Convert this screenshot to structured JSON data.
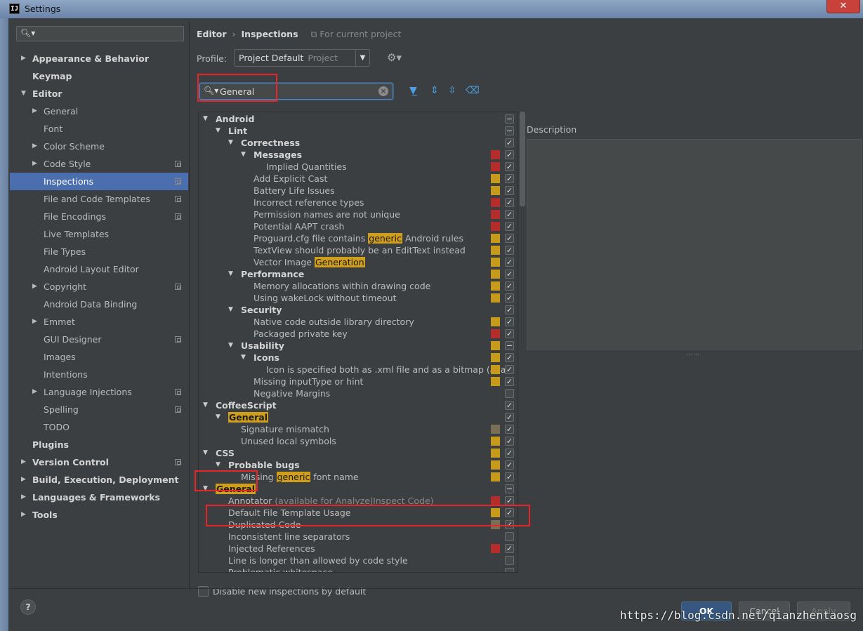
{
  "window": {
    "title": "Settings",
    "app_icon": "IJ",
    "close": "✕"
  },
  "sidebar": {
    "search_placeholder": "",
    "items": [
      {
        "label": "Appearance & Behavior",
        "bold": true,
        "arrow": "▶",
        "level": 0,
        "proj": false
      },
      {
        "label": "Keymap",
        "bold": true,
        "arrow": "",
        "level": 0,
        "proj": false
      },
      {
        "label": "Editor",
        "bold": true,
        "arrow": "▼",
        "level": 0,
        "proj": false
      },
      {
        "label": "General",
        "bold": false,
        "arrow": "▶",
        "level": 1,
        "proj": false
      },
      {
        "label": "Font",
        "bold": false,
        "arrow": "",
        "level": 1,
        "proj": false
      },
      {
        "label": "Color Scheme",
        "bold": false,
        "arrow": "▶",
        "level": 1,
        "proj": false
      },
      {
        "label": "Code Style",
        "bold": false,
        "arrow": "▶",
        "level": 1,
        "proj": true
      },
      {
        "label": "Inspections",
        "bold": false,
        "arrow": "",
        "level": 1,
        "proj": true,
        "selected": true
      },
      {
        "label": "File and Code Templates",
        "bold": false,
        "arrow": "",
        "level": 1,
        "proj": true
      },
      {
        "label": "File Encodings",
        "bold": false,
        "arrow": "",
        "level": 1,
        "proj": true
      },
      {
        "label": "Live Templates",
        "bold": false,
        "arrow": "",
        "level": 1,
        "proj": false
      },
      {
        "label": "File Types",
        "bold": false,
        "arrow": "",
        "level": 1,
        "proj": false
      },
      {
        "label": "Android Layout Editor",
        "bold": false,
        "arrow": "",
        "level": 1,
        "proj": false
      },
      {
        "label": "Copyright",
        "bold": false,
        "arrow": "▶",
        "level": 1,
        "proj": true
      },
      {
        "label": "Android Data Binding",
        "bold": false,
        "arrow": "",
        "level": 1,
        "proj": false
      },
      {
        "label": "Emmet",
        "bold": false,
        "arrow": "▶",
        "level": 1,
        "proj": false
      },
      {
        "label": "GUI Designer",
        "bold": false,
        "arrow": "",
        "level": 1,
        "proj": true
      },
      {
        "label": "Images",
        "bold": false,
        "arrow": "",
        "level": 1,
        "proj": false
      },
      {
        "label": "Intentions",
        "bold": false,
        "arrow": "",
        "level": 1,
        "proj": false
      },
      {
        "label": "Language Injections",
        "bold": false,
        "arrow": "▶",
        "level": 1,
        "proj": true
      },
      {
        "label": "Spelling",
        "bold": false,
        "arrow": "",
        "level": 1,
        "proj": true
      },
      {
        "label": "TODO",
        "bold": false,
        "arrow": "",
        "level": 1,
        "proj": false
      },
      {
        "label": "Plugins",
        "bold": true,
        "arrow": "",
        "level": 0,
        "proj": false
      },
      {
        "label": "Version Control",
        "bold": true,
        "arrow": "▶",
        "level": 0,
        "proj": true
      },
      {
        "label": "Build, Execution, Deployment",
        "bold": true,
        "arrow": "▶",
        "level": 0,
        "proj": false
      },
      {
        "label": "Languages & Frameworks",
        "bold": true,
        "arrow": "▶",
        "level": 0,
        "proj": false
      },
      {
        "label": "Tools",
        "bold": true,
        "arrow": "▶",
        "level": 0,
        "proj": false
      }
    ]
  },
  "breadcrumb": {
    "part1": "Editor",
    "sep": "›",
    "part2": "Inspections",
    "scope": "For current project"
  },
  "profile": {
    "label": "Profile:",
    "value": "Project Default",
    "sub": "Project"
  },
  "filter": {
    "value": "General"
  },
  "colors": {
    "error": "#b52c2a",
    "warning": "#c89a1a",
    "weak": "#7a6e55",
    "highlight": "#cf9e1c",
    "selection": "#4b6eaf"
  },
  "inspections": [
    {
      "label": "Android",
      "level": 0,
      "arrow": "▼",
      "bold": true,
      "sev": "",
      "check": "minus"
    },
    {
      "label": "Lint",
      "level": 1,
      "arrow": "▼",
      "bold": true,
      "sev": "",
      "check": "minus"
    },
    {
      "label": "Correctness",
      "level": 2,
      "arrow": "▼",
      "bold": true,
      "sev": "",
      "check": "on"
    },
    {
      "label": "Messages",
      "level": 3,
      "arrow": "▼",
      "bold": true,
      "sev": "error",
      "check": "on"
    },
    {
      "label": "Implied Quantities",
      "level": 4,
      "arrow": "",
      "bold": false,
      "sev": "error",
      "check": "on"
    },
    {
      "label": "Add Explicit Cast",
      "level": 3,
      "arrow": "",
      "bold": false,
      "sev": "warning",
      "check": "on"
    },
    {
      "label": "Battery Life Issues",
      "level": 3,
      "arrow": "",
      "bold": false,
      "sev": "warning",
      "check": "on"
    },
    {
      "label": "Incorrect reference types",
      "level": 3,
      "arrow": "",
      "bold": false,
      "sev": "error",
      "check": "on"
    },
    {
      "label": "Permission names are not unique",
      "level": 3,
      "arrow": "",
      "bold": false,
      "sev": "error",
      "check": "on"
    },
    {
      "label": "Potential AAPT crash",
      "level": 3,
      "arrow": "",
      "bold": false,
      "sev": "error",
      "check": "on"
    },
    {
      "label": "Proguard.cfg file contains ",
      "hl": "generic",
      "after": " Android rules",
      "level": 3,
      "arrow": "",
      "bold": false,
      "sev": "warning",
      "check": "on"
    },
    {
      "label": "TextView should probably be an EditText instead",
      "level": 3,
      "arrow": "",
      "bold": false,
      "sev": "warning",
      "check": "on"
    },
    {
      "label": "Vector Image ",
      "hl": "Generation",
      "after": "",
      "level": 3,
      "arrow": "",
      "bold": false,
      "sev": "warning",
      "check": "on"
    },
    {
      "label": "Performance",
      "level": 2,
      "arrow": "▼",
      "bold": true,
      "sev": "warning",
      "check": "on"
    },
    {
      "label": "Memory allocations within drawing code",
      "level": 3,
      "arrow": "",
      "bold": false,
      "sev": "warning",
      "check": "on"
    },
    {
      "label": "Using wakeLock without timeout",
      "level": 3,
      "arrow": "",
      "bold": false,
      "sev": "warning",
      "check": "on"
    },
    {
      "label": "Security",
      "level": 2,
      "arrow": "▼",
      "bold": true,
      "sev": "",
      "check": "on"
    },
    {
      "label": "Native code outside library directory",
      "level": 3,
      "arrow": "",
      "bold": false,
      "sev": "warning",
      "check": "on"
    },
    {
      "label": "Packaged private key",
      "level": 3,
      "arrow": "",
      "bold": false,
      "sev": "error",
      "check": "on"
    },
    {
      "label": "Usability",
      "level": 2,
      "arrow": "▼",
      "bold": true,
      "sev": "warning",
      "check": "minus"
    },
    {
      "label": "Icons",
      "level": 3,
      "arrow": "▼",
      "bold": true,
      "sev": "warning",
      "check": "on"
    },
    {
      "label": "Icon is specified both as .xml file and as a bitmap (avai",
      "level": 4,
      "arrow": "",
      "bold": false,
      "sev": "warning",
      "check": "on"
    },
    {
      "label": "Missing inputType or hint",
      "level": 3,
      "arrow": "",
      "bold": false,
      "sev": "warning",
      "check": "on"
    },
    {
      "label": "Negative Margins",
      "level": 3,
      "arrow": "",
      "bold": false,
      "sev": "",
      "check": "off"
    },
    {
      "label": "CoffeeScript",
      "level": 0,
      "arrow": "▼",
      "bold": true,
      "sev": "",
      "check": "on"
    },
    {
      "label": "",
      "hl": "General",
      "after": "",
      "level": 1,
      "arrow": "▼",
      "bold": true,
      "sev": "",
      "check": "on"
    },
    {
      "label": "Signature mismatch",
      "level": 2,
      "arrow": "",
      "bold": false,
      "sev": "weak",
      "check": "on"
    },
    {
      "label": "Unused local symbols",
      "level": 2,
      "arrow": "",
      "bold": false,
      "sev": "warning",
      "check": "on"
    },
    {
      "label": "CSS",
      "level": 0,
      "arrow": "▼",
      "bold": true,
      "sev": "warning",
      "check": "on"
    },
    {
      "label": "Probable bugs",
      "level": 1,
      "arrow": "▼",
      "bold": true,
      "sev": "warning",
      "check": "on"
    },
    {
      "label": "Missing ",
      "hl": "generic",
      "after": " font name",
      "level": 2,
      "arrow": "",
      "bold": false,
      "sev": "warning",
      "check": "on"
    },
    {
      "label": "",
      "hl": "General",
      "after": "",
      "level": 0,
      "arrow": "▼",
      "bold": true,
      "sev": "",
      "check": "minus"
    },
    {
      "label": "Annotator ",
      "after": "(available for Analyze|Inspect Code)",
      "dim": true,
      "level": 1,
      "arrow": "",
      "bold": false,
      "sev": "error",
      "check": "on"
    },
    {
      "label": "Default File Template Usage",
      "level": 1,
      "arrow": "",
      "bold": false,
      "sev": "warning",
      "check": "on"
    },
    {
      "label": "Duplicated Code",
      "level": 1,
      "arrow": "",
      "bold": false,
      "sev": "weak",
      "check": "on"
    },
    {
      "label": "Inconsistent line separators",
      "level": 1,
      "arrow": "",
      "bold": false,
      "sev": "",
      "check": "off"
    },
    {
      "label": "Injected References",
      "level": 1,
      "arrow": "",
      "bold": false,
      "sev": "error",
      "check": "on"
    },
    {
      "label": "Line is longer than allowed by code style",
      "level": 1,
      "arrow": "",
      "bold": false,
      "sev": "",
      "check": "off"
    },
    {
      "label": "Problematic whitespace",
      "level": 1,
      "arrow": "",
      "bold": false,
      "sev": "",
      "check": "off"
    }
  ],
  "description": {
    "label": "Description"
  },
  "disable_new": {
    "label": "Disable new inspections by default"
  },
  "buttons": {
    "help": "?",
    "ok": "OK",
    "cancel": "Cancel",
    "apply": "Apply"
  },
  "watermark": "https://blog.csdn.net/qianzhentaosg"
}
